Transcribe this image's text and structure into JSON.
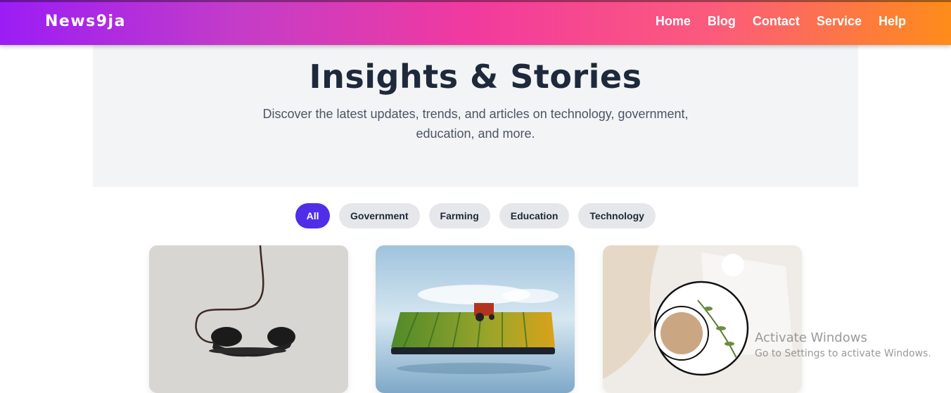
{
  "header": {
    "logo": "News9ja",
    "nav": [
      "Home",
      "Blog",
      "Contact",
      "Service",
      "Help"
    ]
  },
  "hero": {
    "title": "Insights & Stories",
    "subtitle": "Discover the latest updates, trends, and articles on technology, government, education, and more."
  },
  "filters": [
    "All",
    "Government",
    "Farming",
    "Education",
    "Technology"
  ],
  "active_filter": "All",
  "cards": [
    {
      "image": "telephone-handset-image"
    },
    {
      "image": "farm-phone-image"
    },
    {
      "image": "coffee-cup-image"
    }
  ],
  "watermark": {
    "line1": "Activate Windows",
    "line2": "Go to Settings to activate Windows."
  },
  "colors": {
    "accent": "#4f2ee8",
    "heading": "#1e293b",
    "gradient_start": "#9b1df5",
    "gradient_end": "#fe8c1a"
  }
}
